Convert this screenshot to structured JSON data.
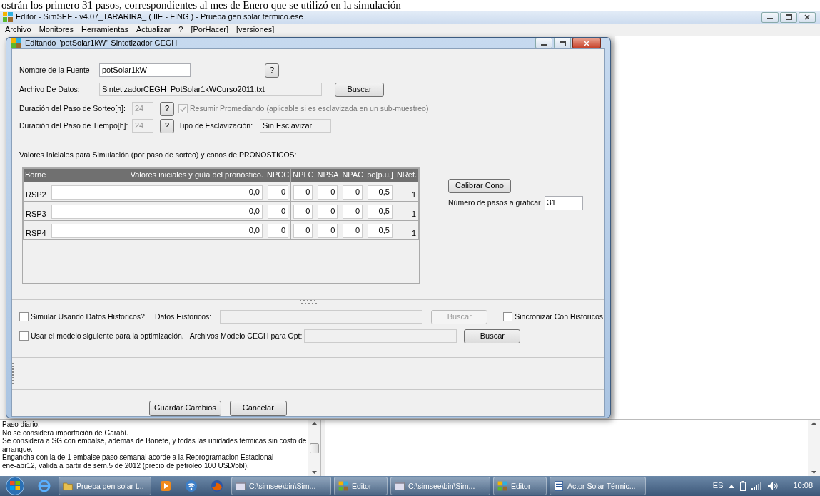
{
  "document_caption": "ostrán los primero 31 pasos, correspondientes al mes de Enero que se utilizó en la simulación",
  "app": {
    "title": "Editor - SimSEE - v4.07_TARARIRA_ ( IIE - FING ) - Prueba gen solar termico.ese",
    "menu": [
      "Archivo",
      "Monitores",
      "Herramientas",
      "Actualizar",
      "?",
      "[PorHacer]",
      "[versiones]"
    ]
  },
  "dialog": {
    "title": "Editando \"potSolar1kW\" Sintetizador CEGH",
    "source_name": {
      "label": "Nombre de la Fuente",
      "value": "potSolar1kW",
      "help": "?"
    },
    "data_file": {
      "label": "Archivo De Datos:",
      "value": "SintetizadorCEGH_PotSolar1kWCurso2011.txt",
      "button": "Buscar"
    },
    "draw_step": {
      "label": "Duración del Paso de Sorteo[h]:",
      "value": "24",
      "disabled": true,
      "help": "?",
      "summarize": {
        "label": "Resumir Promediando (aplicable si es esclavizada en un sub-muestreo)",
        "checked": true,
        "disabled": true
      }
    },
    "time_step": {
      "label": "Duración del Paso de Tiempo[h]:",
      "value": "24",
      "disabled": true,
      "help": "?",
      "slaving_label": "Tipo de Esclavización:",
      "slaving_value": "Sin Esclavizar"
    },
    "forecast": {
      "title": "Valores Iniciales para Simulación (por paso de sorteo) y conos de  PRONOSTICOS:",
      "columns": [
        "Borne",
        "Valores iniciales y guía del pronóstico.",
        "NPCC",
        "NPLC",
        "NPSA",
        "NPAC",
        "pe[p.u.]",
        "NRet."
      ],
      "rows": [
        {
          "cells": [
            "RSP2",
            "0,0",
            "0",
            "0",
            "0",
            "0",
            "0,5",
            "1"
          ]
        },
        {
          "cells": [
            "RSP3",
            "0,0",
            "0",
            "0",
            "0",
            "0",
            "0,5",
            "1"
          ]
        },
        {
          "cells": [
            "RSP4",
            "0,0",
            "0",
            "0",
            "0",
            "0",
            "0,5",
            "1"
          ]
        }
      ],
      "calibrate_button": "Calibrar Cono",
      "steps_label": "Número de pasos a  graficar",
      "steps_value": "31"
    },
    "history": {
      "simulate": {
        "label": "Simular Usando Datos Historicos?",
        "checked": false
      },
      "data_label": "Datos Historicos:",
      "button": {
        "label": "Buscar",
        "disabled": true
      },
      "sync": {
        "label": "Sincronizar Con Historicos",
        "checked": false
      }
    },
    "optimization": {
      "use": {
        "label": "Usar el modelo siguiente para la optimización.",
        "checked": false
      },
      "files_label": "Archivos Modelo CEGH para Opt:",
      "button": {
        "label": "Buscar",
        "disabled": false
      }
    },
    "buttons": [
      "Guardar Cambios",
      "Cancelar"
    ]
  },
  "notes": [
    "Paso diario.",
    "No se considera importación de Garabí.",
    "Se considera a SG con embalse, además de Bonete, y todas las unidades térmicas sin costo de",
    "arranque.",
    "Engancha con la de 1 embalse paso semanal acorde a la Reprogramacion Estacional",
    "ene-abr12, valida a partir de sem.5 de 2012 (precio de petroleo 100 USD/bbl)."
  ],
  "taskbar": {
    "buttons": [
      {
        "label": "Prueba gen solar t..."
      },
      {
        "label": "C:\\simsee\\bin\\Sim..."
      },
      {
        "label": "Editor"
      },
      {
        "label": "C:\\simsee\\bin\\Sim..."
      },
      {
        "label": "Editor"
      },
      {
        "label": "Actor Solar Térmic..."
      }
    ],
    "language": "ES",
    "clock": "10:08"
  }
}
